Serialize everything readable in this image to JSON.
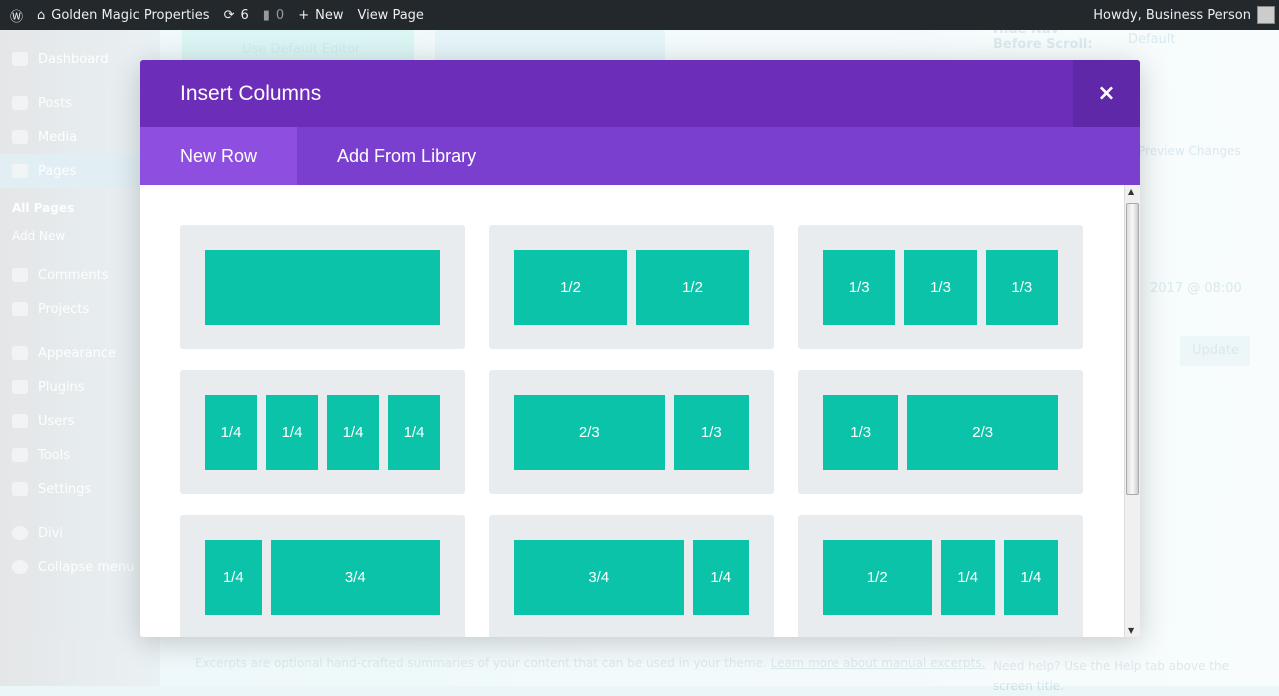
{
  "adminbar": {
    "site": "Golden Magic Properties",
    "updates": "6",
    "comments": "0",
    "new": "New",
    "view": "View Page",
    "howdy": "Howdy, Business Person"
  },
  "sidebar": {
    "items": [
      "Dashboard",
      "Posts",
      "Media",
      "Pages"
    ],
    "sub": [
      "All Pages",
      "Add New"
    ],
    "items2": [
      "Comments",
      "Projects",
      "Appearance",
      "Plugins",
      "Users",
      "Tools",
      "Settings",
      "Divi",
      "Collapse menu"
    ]
  },
  "background": {
    "default_editor": "Use Default Editor",
    "hide_nav": "Hide Nav Before Scroll:",
    "select_value": "Default",
    "preview": "Preview Changes",
    "date": "2017 @ 08:00",
    "update": "Update",
    "excerpt": "Excerpts are optional hand-crafted summaries of your content that can be used in your theme.",
    "excerpt_link": "Learn more about manual excerpts.",
    "help": "Need help? Use the Help tab above the screen title."
  },
  "modal": {
    "title": "Insert Columns",
    "close": "×",
    "tabs": [
      "New Row",
      "Add From Library"
    ]
  },
  "layouts": [
    [
      {
        "f": 1,
        "l": ""
      }
    ],
    [
      {
        "f": 1,
        "l": "1/2"
      },
      {
        "f": 1,
        "l": "1/2"
      }
    ],
    [
      {
        "f": 1,
        "l": "1/3"
      },
      {
        "f": 1,
        "l": "1/3"
      },
      {
        "f": 1,
        "l": "1/3"
      }
    ],
    [
      {
        "f": 1,
        "l": "1/4"
      },
      {
        "f": 1,
        "l": "1/4"
      },
      {
        "f": 1,
        "l": "1/4"
      },
      {
        "f": 1,
        "l": "1/4"
      }
    ],
    [
      {
        "f": 2,
        "l": "2/3"
      },
      {
        "f": 1,
        "l": "1/3"
      }
    ],
    [
      {
        "f": 1,
        "l": "1/3"
      },
      {
        "f": 2,
        "l": "2/3"
      }
    ],
    [
      {
        "f": 1,
        "l": "1/4"
      },
      {
        "f": 3,
        "l": "3/4"
      }
    ],
    [
      {
        "f": 3,
        "l": "3/4"
      },
      {
        "f": 1,
        "l": "1/4"
      }
    ],
    [
      {
        "f": 2,
        "l": "1/2"
      },
      {
        "f": 1,
        "l": "1/4"
      },
      {
        "f": 1,
        "l": "1/4"
      }
    ]
  ],
  "colors": {
    "header": "#6c2eb9",
    "tabs": "#7b3fd0",
    "column": "#0bc3a8",
    "card": "#e9ecef"
  }
}
